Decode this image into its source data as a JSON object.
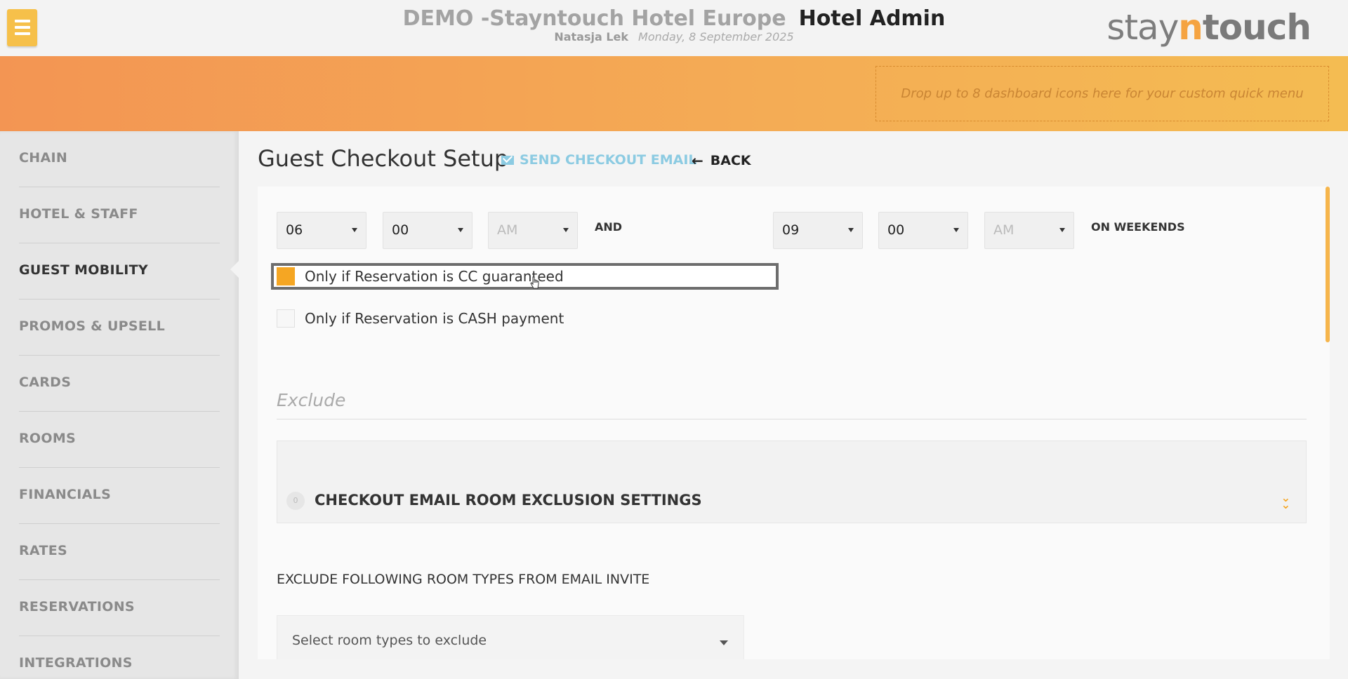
{
  "header": {
    "hotel_name": "DEMO -Stayntouch Hotel Europe",
    "app_name": "Hotel Admin",
    "user": "Natasja Lek",
    "date": "Monday, 8 September 2025",
    "logo": {
      "part1": "stay",
      "part2": "n",
      "part3": "touch"
    },
    "menu_icon": "hamburger-icon"
  },
  "quick_menu": {
    "placeholder": "Drop up to 8 dashboard icons here for your custom quick menu"
  },
  "sidebar": {
    "items": [
      {
        "label": "CHAIN",
        "active": false
      },
      {
        "label": "HOTEL & STAFF",
        "active": false
      },
      {
        "label": "GUEST MOBILITY",
        "active": true
      },
      {
        "label": "PROMOS & UPSELL",
        "active": false
      },
      {
        "label": "CARDS",
        "active": false
      },
      {
        "label": "ROOMS",
        "active": false
      },
      {
        "label": "FINANCIALS",
        "active": false
      },
      {
        "label": "RATES",
        "active": false
      },
      {
        "label": "RESERVATIONS",
        "active": false
      },
      {
        "label": "INTEGRATIONS",
        "active": false
      }
    ]
  },
  "page": {
    "title": "Guest Checkout Setup",
    "send_email": "SEND CHECKOUT EMAIL",
    "back": "BACK"
  },
  "time_row": {
    "start": {
      "hour": "06",
      "minute": "00",
      "ampm": "AM"
    },
    "and_label": "AND",
    "end": {
      "hour": "09",
      "minute": "00",
      "ampm": "AM"
    },
    "suffix": "ON WEEKENDS"
  },
  "checkboxes": [
    {
      "label": "Only if Reservation is CC guaranteed",
      "checked": true
    },
    {
      "label": "Only if Reservation is CASH payment",
      "checked": false
    }
  ],
  "exclude": {
    "heading": "Exclude",
    "accordion_badge": "0",
    "accordion_title": "CHECKOUT EMAIL ROOM EXCLUSION SETTINGS",
    "room_types_label": "EXCLUDE FOLLOWING ROOM TYPES FROM EMAIL INVITE",
    "room_types_placeholder": "Select room types to exclude"
  },
  "colors": {
    "accent": "#f5a623",
    "link": "#8ccbe2",
    "band_start": "#f39553",
    "band_end": "#f4bc52"
  }
}
